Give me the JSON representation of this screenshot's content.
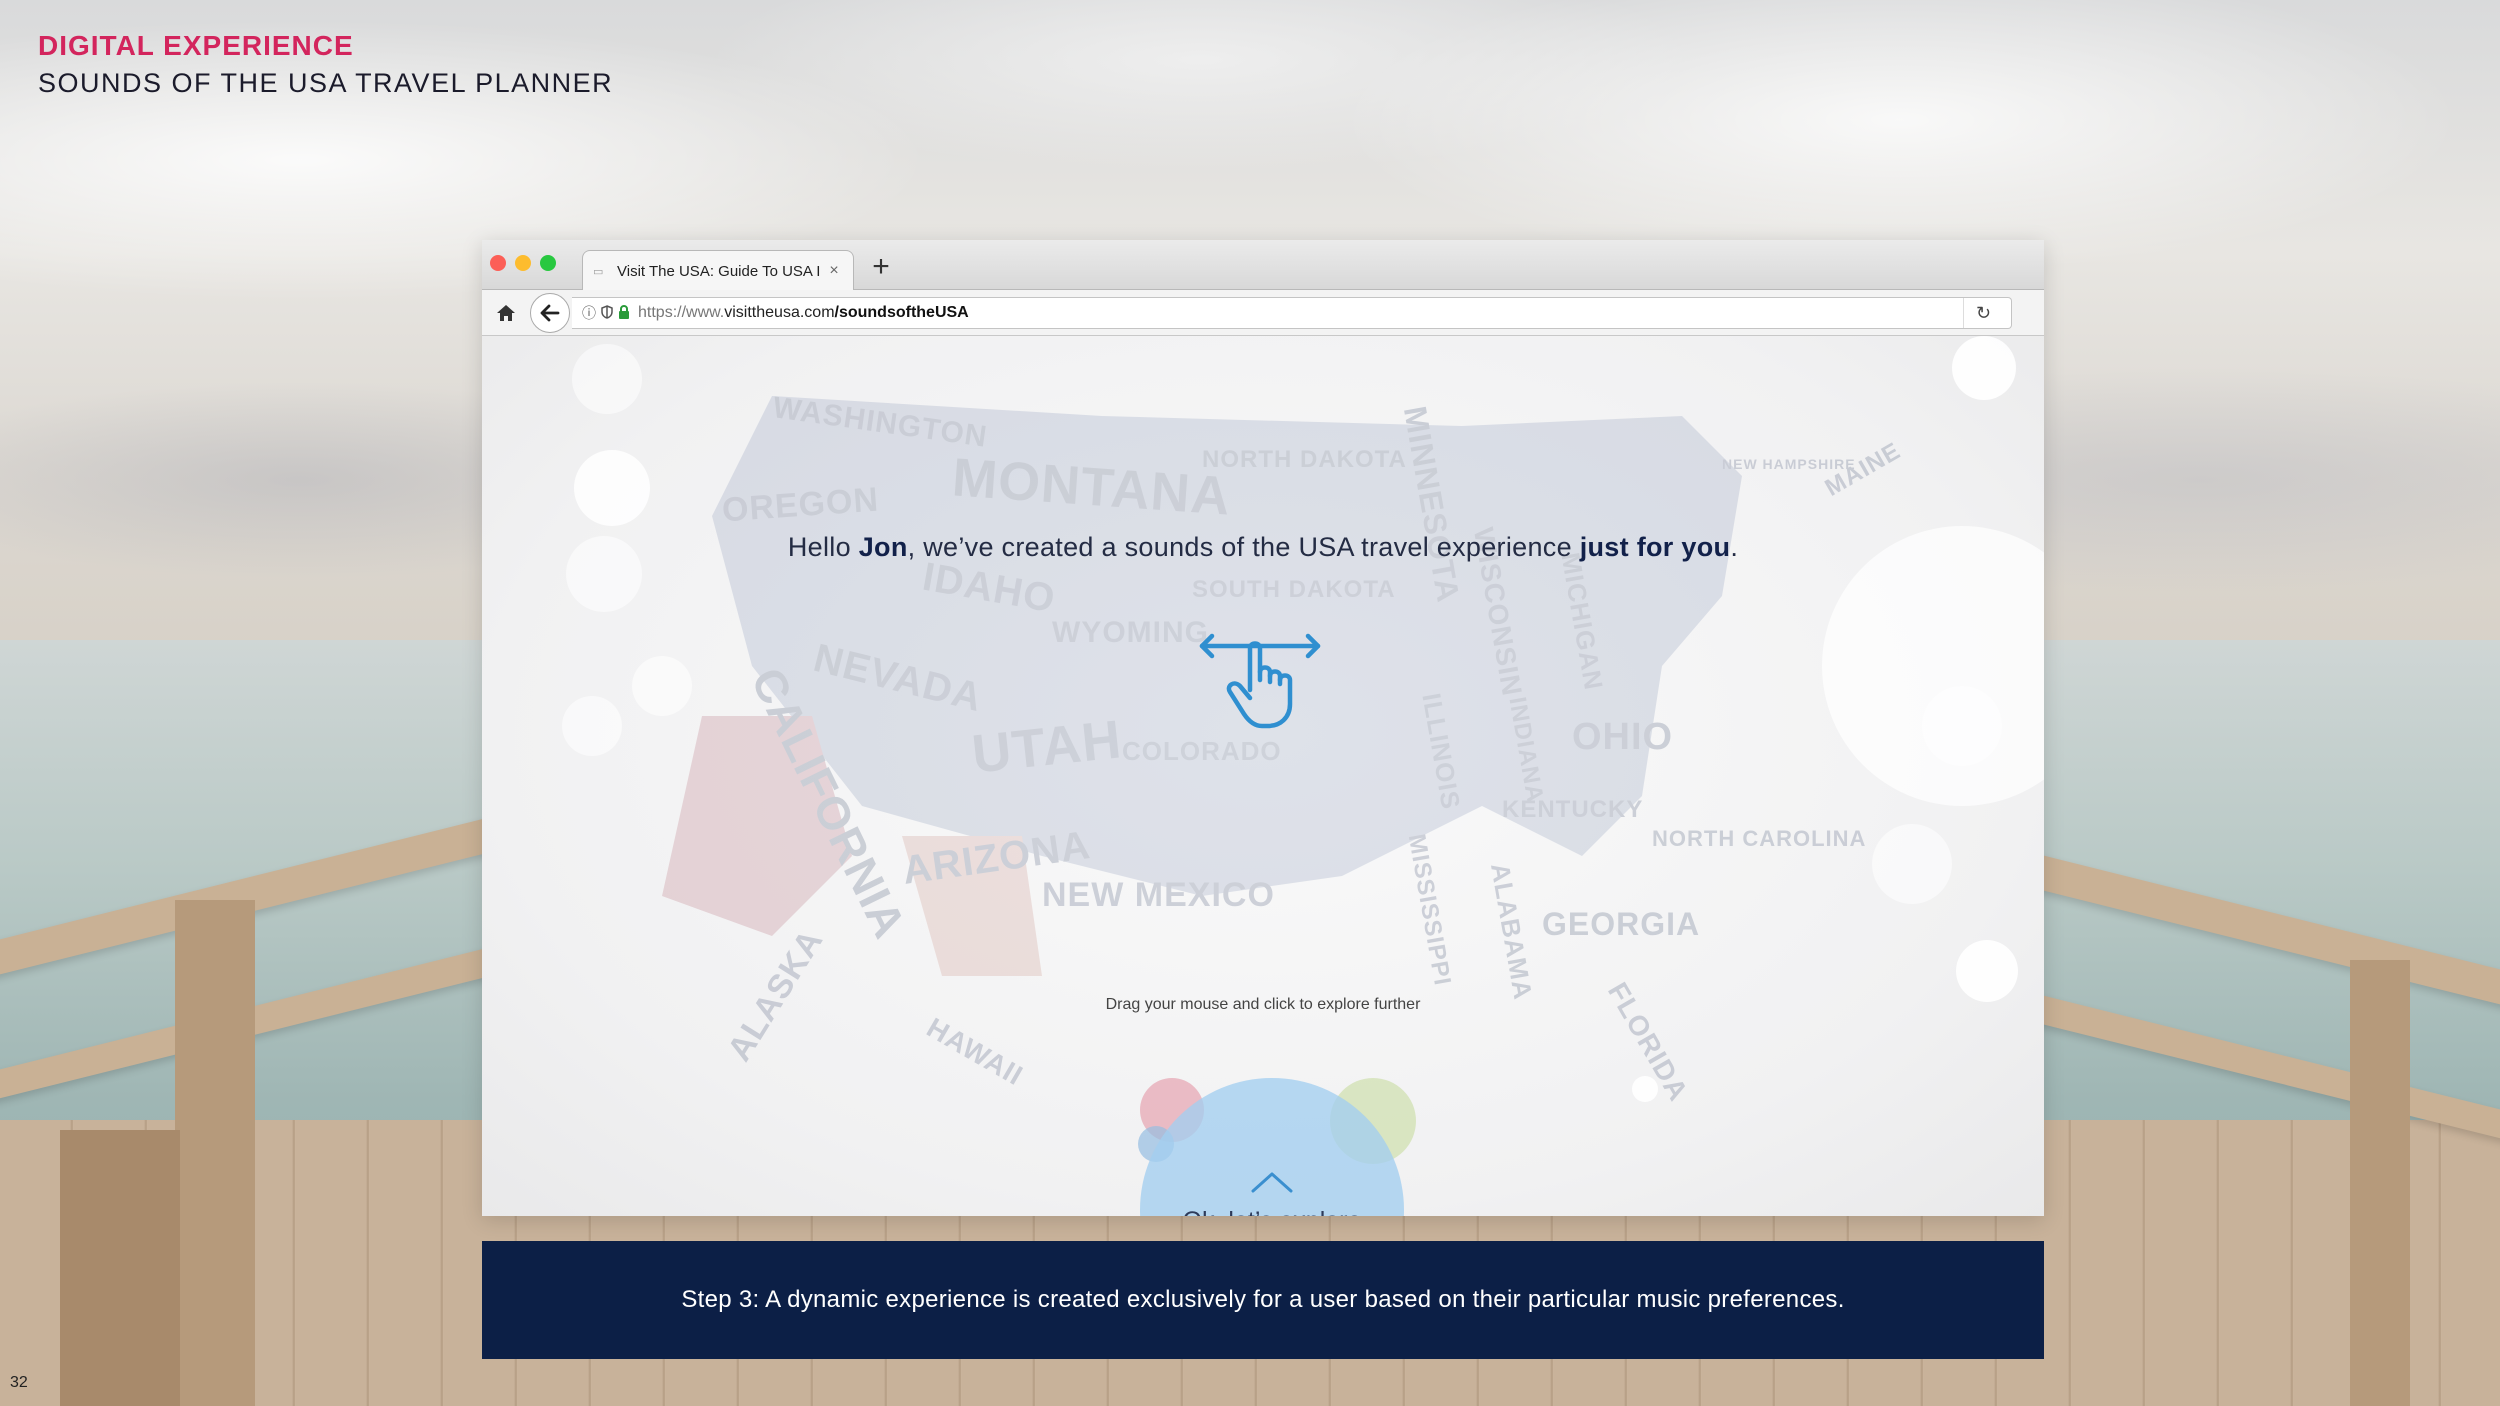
{
  "slide": {
    "kicker": "DIGITAL EXPERIENCE",
    "subtitle": "SOUNDS OF THE USA TRAVEL PLANNER",
    "page_number": "32"
  },
  "browser": {
    "tab_title": "Visit The USA: Guide To USA I",
    "url": {
      "protocol": "https://www.",
      "domain": "visittheusa.com",
      "path": "/soundsoftheUSA"
    }
  },
  "page": {
    "greeting": {
      "prefix": "Hello ",
      "name": "Jon",
      "middle": ", we’ve created a sounds of the USA travel experience ",
      "emphasis": "just for you",
      "suffix": "."
    },
    "instruction": "Drag your mouse and click to explore further",
    "explore_button": "Ok, let’s explore",
    "map_states": [
      "WASHINGTON",
      "MONTANA",
      "NORTH DAKOTA",
      "SOUTH DAKOTA",
      "IDAHO",
      "WYOMING",
      "OREGON",
      "NEVADA",
      "CALIFORNIA",
      "UTAH",
      "ARIZONA",
      "NEW MEXICO",
      "ALASKA",
      "HAWAII",
      "MINNESOTA",
      "WISCONSIN",
      "MICHIGAN",
      "ILLINOIS",
      "INDIANA",
      "OHIO",
      "KENTUCKY",
      "MISSISSIPPI",
      "ALABAMA",
      "GEORGIA",
      "FLORIDA",
      "NORTH CAROLINA",
      "MAINE",
      "NEW HAMPSHIRE",
      "COLORADO"
    ]
  },
  "caption": "Step 3: A dynamic experience is created exclusively for a user based on their particular music preferences.",
  "colors": {
    "accent": "#d3255d",
    "navy": "#0c1f46",
    "explore_blue": "#a3cef0",
    "gesture_blue": "#2f8fd0"
  },
  "icons": [
    "home-icon",
    "back-arrow-icon",
    "info-icon",
    "shield-icon",
    "lock-icon",
    "reload-icon",
    "swipe-hand-icon",
    "chevron-up-icon",
    "close-icon",
    "plus-icon"
  ]
}
